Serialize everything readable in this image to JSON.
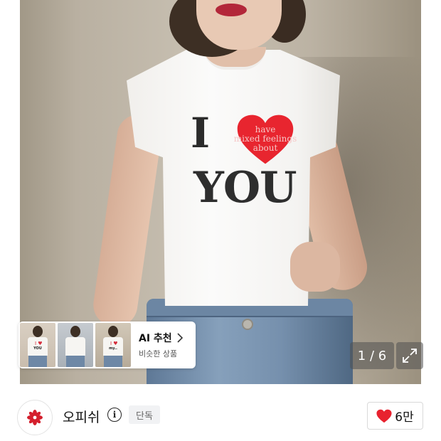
{
  "product_image": {
    "print_line1": "I",
    "print_phrase": [
      "have",
      "mixed feelings",
      "about"
    ],
    "print_line2": "YOU",
    "heart_color": "#e8252f"
  },
  "ai_recommend": {
    "title": "AI 추천",
    "subtitle": "비슷한 상품",
    "chevron_icon": "chevron-right-icon",
    "thumbnails": [
      {
        "print_top": "I ♥",
        "print_bottom": "YOU"
      },
      {
        "print_top": "",
        "print_bottom": ""
      },
      {
        "print_top": "I ♥",
        "print_bottom": "my.."
      }
    ]
  },
  "image_counter": {
    "current": 1,
    "total": 6,
    "label": "1 / 6"
  },
  "expand_icon": "expand-arrows-icon",
  "brand": {
    "name": "오피쉬",
    "logo_color": "#d41f2d",
    "info_icon": "info-icon",
    "badge": "단독"
  },
  "like": {
    "icon": "heart-icon",
    "count": "6만",
    "color": "#e8222f"
  }
}
